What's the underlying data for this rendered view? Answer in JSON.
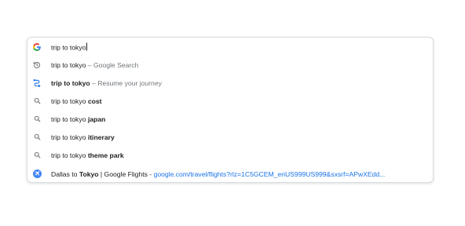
{
  "omnibox": {
    "input_value": "trip to tokyo",
    "suggestions": [
      {
        "icon": "history-icon",
        "parts": [
          "trip to tokyo",
          " – Google Search"
        ]
      },
      {
        "icon": "resume-journey-icon",
        "parts": [
          "trip to tokyo",
          " – Resume your journey"
        ]
      },
      {
        "icon": "search-icon",
        "parts": [
          "trip to tokyo ",
          "cost"
        ]
      },
      {
        "icon": "search-icon",
        "parts": [
          "trip to tokyo ",
          "japan"
        ]
      },
      {
        "icon": "search-icon",
        "parts": [
          "trip to tokyo ",
          "itinerary"
        ]
      },
      {
        "icon": "search-icon",
        "parts": [
          "trip to tokyo ",
          "theme park"
        ]
      },
      {
        "icon": "google-flights-icon",
        "parts": [
          "Dallas to ",
          "Tokyo",
          " | Google Flights - ",
          "google.com/travel/flights?rlz=1C5GCEM_enUS999US999&sxsrf=APwXEdd..."
        ]
      }
    ]
  },
  "colors": {
    "google_blue": "#4285f4",
    "google_red": "#ea4335",
    "google_yellow": "#fbbc05",
    "google_green": "#34a853",
    "link_blue": "#1a73e8",
    "muted_gray": "#70757a"
  }
}
